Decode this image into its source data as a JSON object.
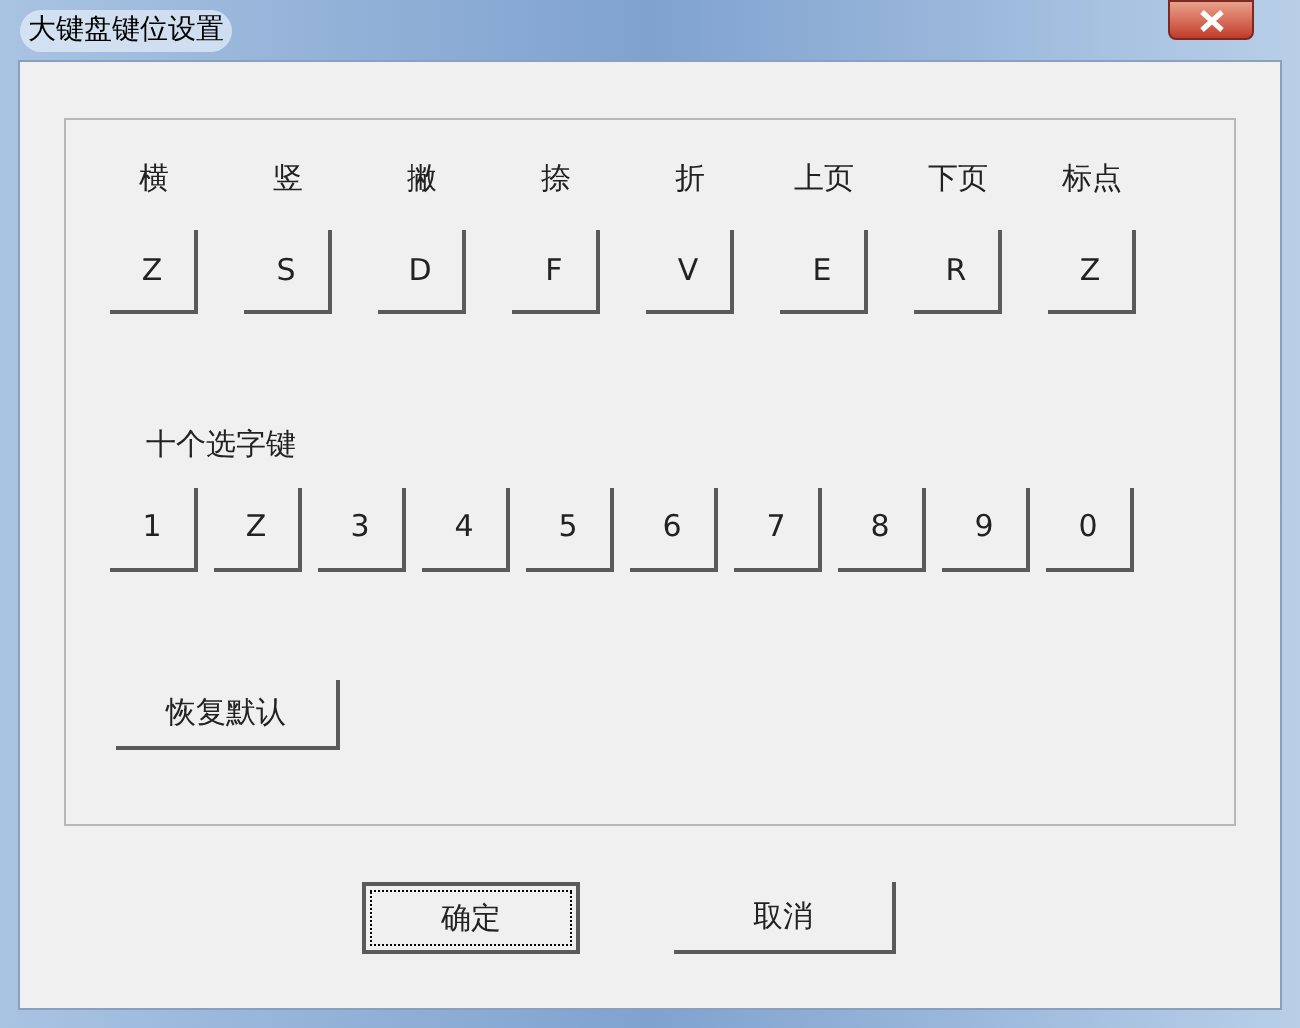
{
  "window": {
    "title": "大键盘键位设置"
  },
  "stroke_keys": [
    {
      "label": "横",
      "key": "Z"
    },
    {
      "label": "竖",
      "key": "S"
    },
    {
      "label": "撇",
      "key": "D"
    },
    {
      "label": "捺",
      "key": "F"
    },
    {
      "label": "折",
      "key": "V"
    },
    {
      "label": "上页",
      "key": "E"
    },
    {
      "label": "下页",
      "key": "R"
    },
    {
      "label": "标点",
      "key": "Z"
    }
  ],
  "selection_keys": {
    "label": "十个选字键",
    "keys": [
      "1",
      "Z",
      "3",
      "4",
      "5",
      "6",
      "7",
      "8",
      "9",
      "0"
    ]
  },
  "reset_button": "恢复默认",
  "buttons": [
    {
      "label": "确定",
      "focused": true
    },
    {
      "label": "取消",
      "focused": false
    }
  ]
}
